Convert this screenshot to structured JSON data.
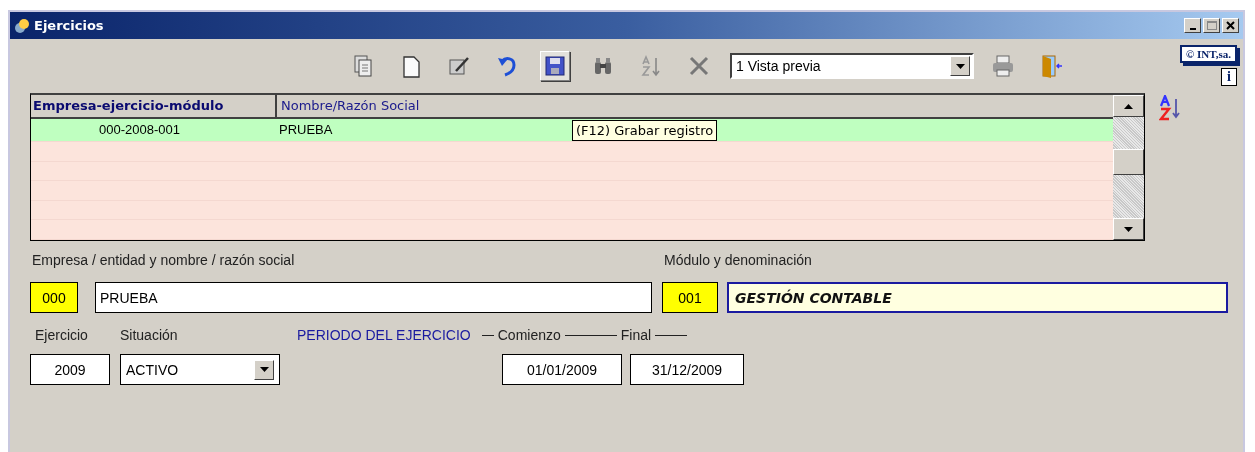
{
  "window": {
    "title": "Ejercicios"
  },
  "toolbar": {
    "buttons": [
      {
        "pressed": false
      },
      {
        "pressed": false
      },
      {
        "pressed": false
      },
      {
        "pressed": false
      },
      {
        "pressed": true
      },
      {
        "pressed": false
      },
      {
        "pressed": false
      },
      {
        "pressed": false
      }
    ],
    "report_select": {
      "value": "1 Vista previa"
    },
    "badge": "© INT,sa.",
    "info": "i"
  },
  "tooltip": "(F12) Grabar registro",
  "table": {
    "columns": [
      "Empresa-ejercicio-módulo",
      "Nombre/Razón Social"
    ],
    "rows": [
      {
        "cells": [
          "000-2008-001",
          "PRUEBA"
        ],
        "selected": true
      }
    ]
  },
  "form": {
    "empresa_label": "Empresa / entidad y nombre / razón social",
    "empresa_code": "000",
    "empresa_name": "PRUEBA",
    "modulo_label": "Módulo y denominación",
    "modulo_code": "001",
    "modulo_name": "GESTIÓN CONTABLE",
    "ejercicio_label": "Ejercicio",
    "situacion_label": "Situación",
    "periodo_label": "PERIODO DEL EJERCICIO",
    "comienzo_label": "Comienzo",
    "final_label": "Final",
    "ejercicio": "2009",
    "situacion": "ACTIVO",
    "comienzo": "01/01/2009",
    "final": "31/12/2009"
  }
}
